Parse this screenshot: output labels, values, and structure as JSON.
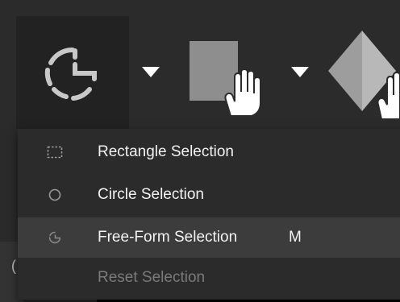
{
  "toolbar": {
    "tools": [
      {
        "name": "Free-Form Selection",
        "icon": "free-form-selection-icon",
        "active": true
      },
      {
        "name": "Select and move",
        "icon": "rectangle-hand-icon"
      },
      {
        "name": "3D shape",
        "icon": "pyramid-hand-icon"
      }
    ]
  },
  "selection_menu": {
    "items": [
      {
        "label": "Rectangle Selection",
        "icon": "dashed-rectangle-icon",
        "shortcut": "",
        "enabled": true
      },
      {
        "label": "Circle Selection",
        "icon": "circle-outline-icon",
        "shortcut": "",
        "enabled": true
      },
      {
        "label": "Free-Form Selection",
        "icon": "free-form-selection-icon",
        "shortcut": "M",
        "enabled": true,
        "highlighted": true
      },
      {
        "label": "Reset Selection",
        "icon": "",
        "shortcut": "",
        "enabled": false
      }
    ]
  },
  "left_glyph": "(",
  "colors": {
    "toolbar_bg": "#2b2b2b",
    "menu_bg": "#2b2b2b",
    "menu_hover": "#3c3c3c",
    "text": "#f2f2f2",
    "disabled_text": "#7a7a7a",
    "icon_gray": "#9a9a9a"
  }
}
